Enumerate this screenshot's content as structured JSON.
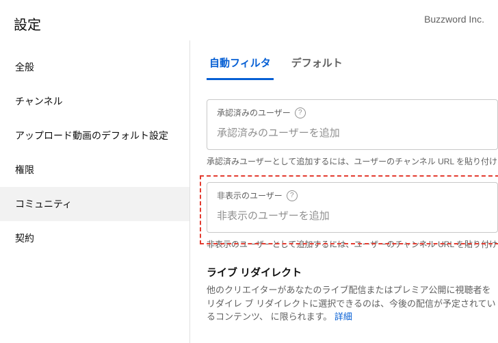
{
  "header": {
    "title": "設定",
    "brand": "Buzzword Inc."
  },
  "sidebar": {
    "items": [
      {
        "label": "全般"
      },
      {
        "label": "チャンネル"
      },
      {
        "label": "アップロード動画のデフォルト設定"
      },
      {
        "label": "権限"
      },
      {
        "label": "コミュニティ"
      },
      {
        "label": "契約"
      }
    ]
  },
  "tabs": {
    "active": "自動フィルタ",
    "other": "デフォルト"
  },
  "approved": {
    "label": "承認済みのユーザー",
    "placeholder": "承認済みのユーザーを追加",
    "hint": "承認済みユーザーとして追加するには、ユーザーのチャンネル URL を貼り付け"
  },
  "hidden": {
    "label": "非表示のユーザー",
    "placeholder": "非表示のユーザーを追加",
    "hint": "非表示のユーザーとして追加するには、ユーザーのチャンネル URL を貼り付け"
  },
  "redirect": {
    "title": "ライブ リダイレクト",
    "desc": "他のクリエイターがあなたのライブ配信またはプレミア公開に視聴者をリダイレ\nブ リダイレクトに選択できるのは、今後の配信が予定されているコンテンツ、\nに限られます。",
    "link": "詳細"
  }
}
